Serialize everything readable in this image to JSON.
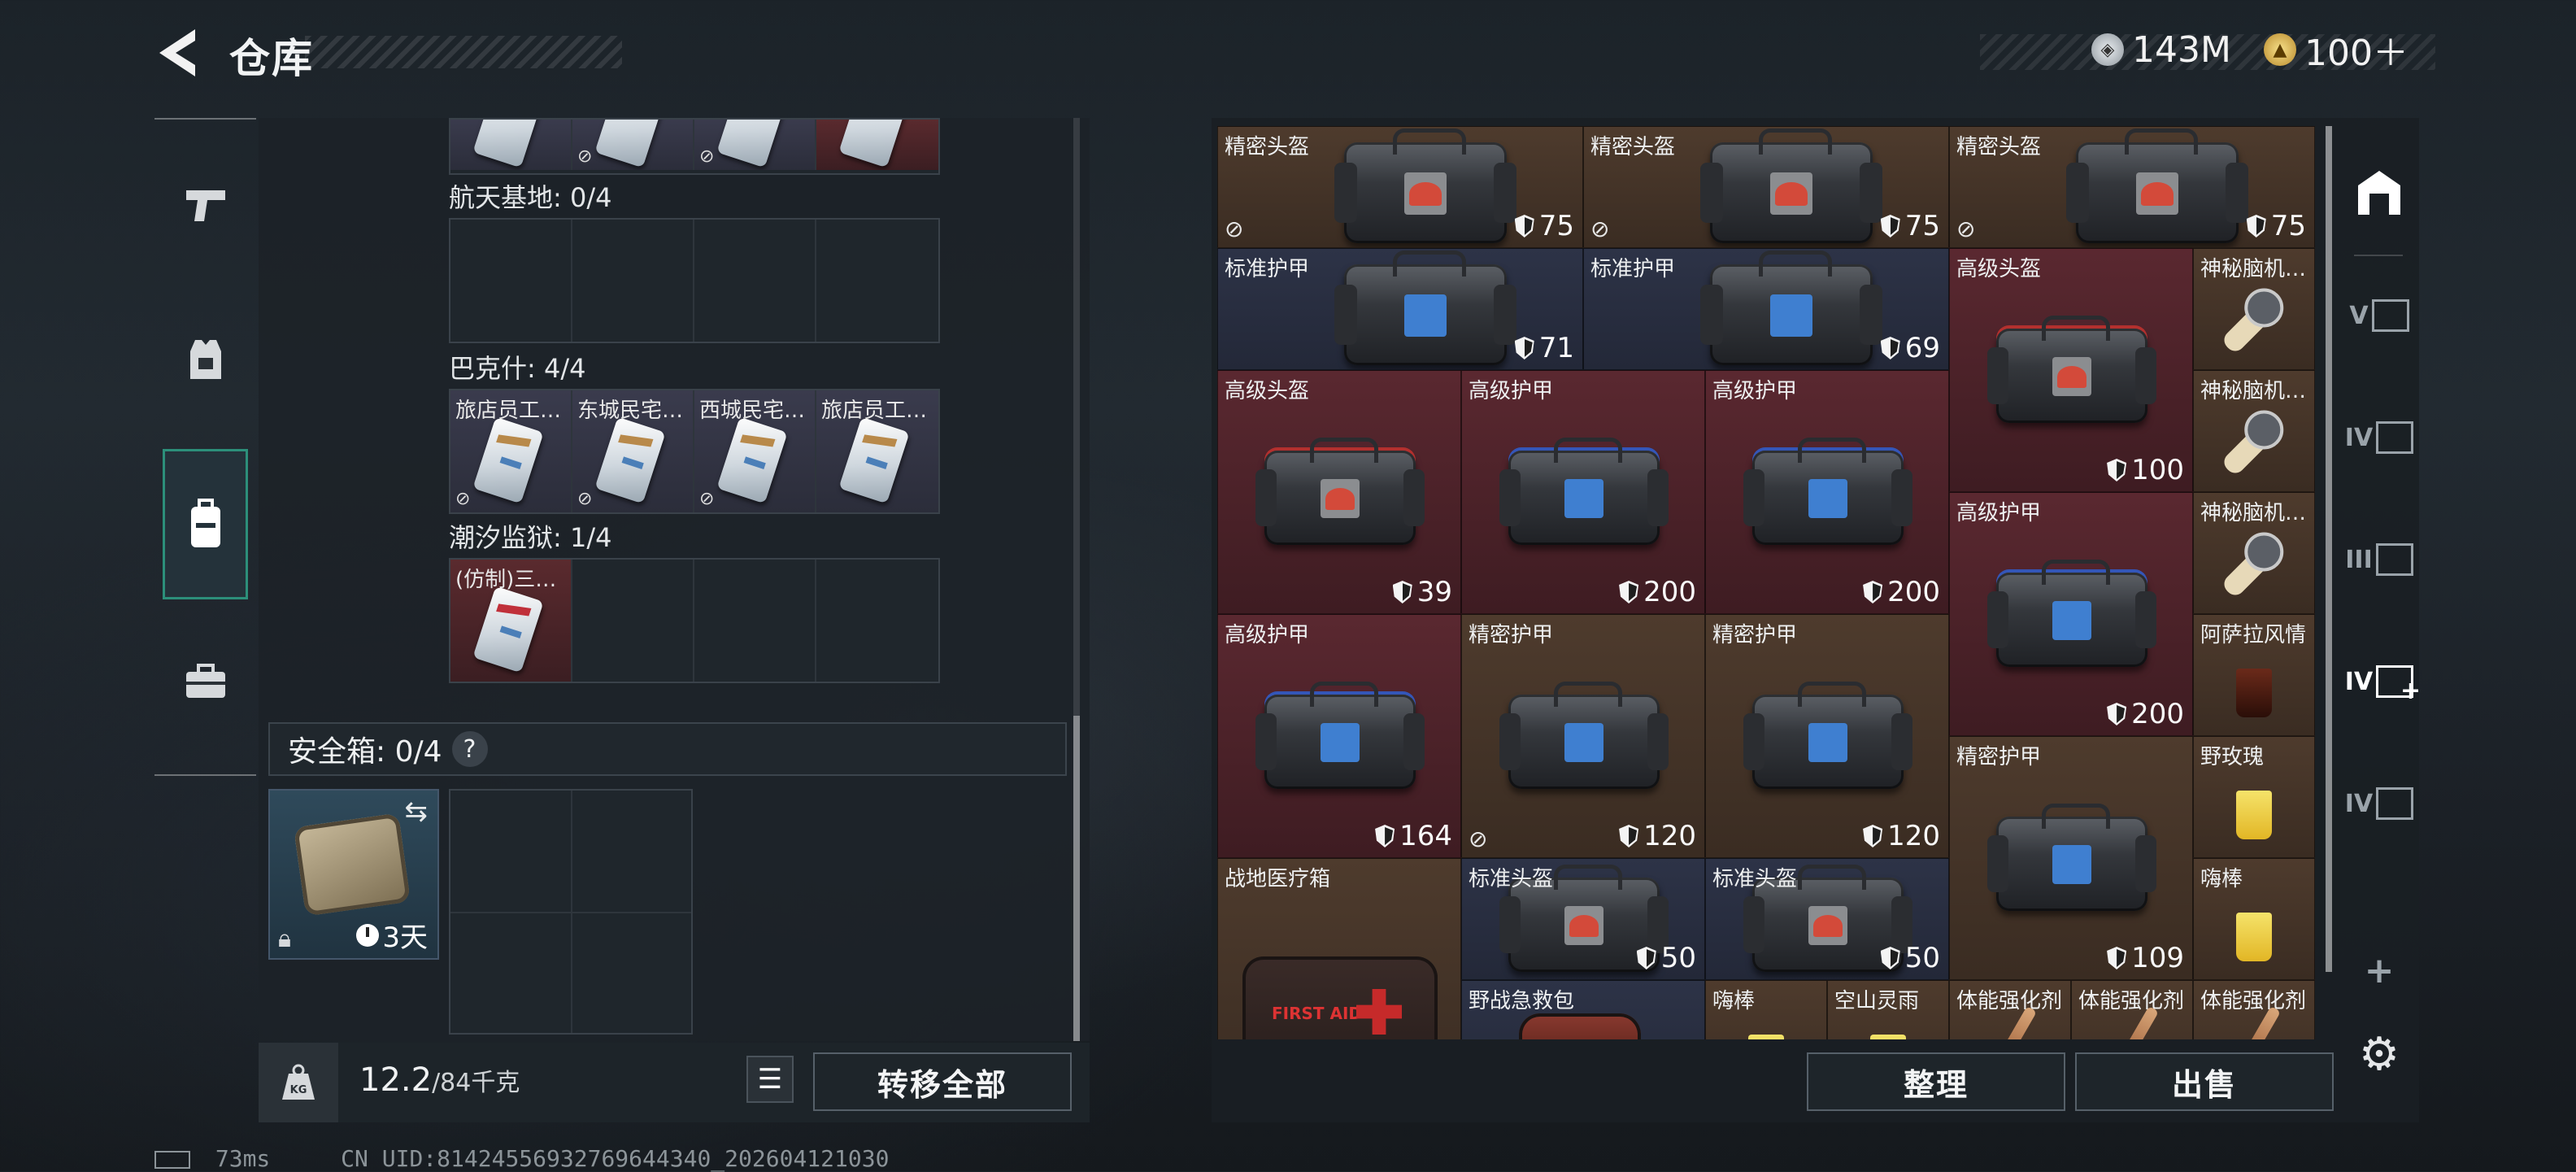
{
  "header": {
    "title": "仓库",
    "currencies": [
      {
        "icon": "silver-coin-icon",
        "value": "143M"
      },
      {
        "icon": "gold-coin-icon",
        "value": "100＋"
      }
    ]
  },
  "left_nav": [
    "pistol-tab-icon",
    "vest-tab-icon",
    "backpack-tab-icon",
    "briefcase-tab-icon"
  ],
  "key_groups": [
    {
      "label": "航天基地: 0/4",
      "slots": [
        null,
        null,
        null,
        null
      ]
    },
    {
      "label": "巴克什: 4/4",
      "slots": [
        "旅店员工…",
        "东城民宅…",
        "西城民宅…",
        "旅店员工…"
      ]
    },
    {
      "label": "潮汐监狱: 1/4",
      "slots": [
        "(仿制)三…",
        null,
        null,
        null
      ]
    }
  ],
  "safebox": {
    "label": "安全箱: 0/4",
    "help": "?",
    "timer": "3天"
  },
  "capacity": {
    "current": "12.2",
    "max": "/84千克"
  },
  "buttons": {
    "transfer_all": "转移全部",
    "sort": "整理",
    "sell": "出售"
  },
  "stash_items": [
    {
      "name": "精密头盔",
      "durability": "75"
    },
    {
      "name": "精密头盔",
      "durability": "75"
    },
    {
      "name": "精密头盔",
      "durability": "75"
    },
    {
      "name": "标准护甲",
      "durability": "71"
    },
    {
      "name": "标准护甲",
      "durability": "69"
    },
    {
      "name": "高级头盔",
      "durability": "100"
    },
    {
      "name": "神秘脑机…"
    },
    {
      "name": "神秘脑机…"
    },
    {
      "name": "高级头盔",
      "durability": "39"
    },
    {
      "name": "高级护甲",
      "durability": "200"
    },
    {
      "name": "高级护甲",
      "durability": "200"
    },
    {
      "name": "高级护甲",
      "durability": "200"
    },
    {
      "name": "神秘脑机…"
    },
    {
      "name": "阿萨拉风情"
    },
    {
      "name": "高级护甲",
      "durability": "164"
    },
    {
      "name": "精密护甲",
      "durability": "120"
    },
    {
      "name": "精密护甲",
      "durability": "120"
    },
    {
      "name": "精密护甲",
      "durability": "109"
    },
    {
      "name": "野玫瑰"
    },
    {
      "name": "嗨棒"
    },
    {
      "name": "战地医疗箱"
    },
    {
      "name": "标准头盔",
      "durability": "50"
    },
    {
      "name": "标准头盔",
      "durability": "50"
    },
    {
      "name": "野战急救包"
    },
    {
      "name": "嗨棒"
    },
    {
      "name": "空山灵雨"
    },
    {
      "name": "体能强化剂"
    },
    {
      "name": "体能强化剂"
    },
    {
      "name": "体能强化剂"
    }
  ],
  "right_tabs": [
    "V",
    "IV",
    "III",
    "IV",
    "IV"
  ],
  "footer": {
    "latency": "73ms",
    "uid": "CN UID:814245569327696443​40_202604121030"
  }
}
